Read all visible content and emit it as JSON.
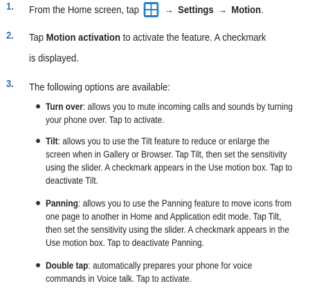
{
  "accent_color": "#2a6fb0",
  "icon_color": "#1f7fcf",
  "icons": [
    "apps-icon",
    "arrow-icon"
  ],
  "steps": [
    {
      "num": "1.",
      "pre": "From the Home screen, tap",
      "arrow": "→",
      "settings": "Settings",
      "motion": "Motion",
      "end": "."
    },
    {
      "num": "2.",
      "pre": "Tap",
      "bold": "Motion activation",
      "post": "to activate the feature. A checkmark",
      "line2": "is displayed."
    },
    {
      "num": "3.",
      "text": "The following options are available:"
    }
  ],
  "options": [
    {
      "term": "Turn over",
      "lines": [
        ": allows you to mute incoming calls and sounds by turning",
        "your phone over. Tap to activate."
      ]
    },
    {
      "term": "Tilt",
      "lines": [
        ": allows you to use the Tilt feature to reduce or enlarge the",
        "screen when in Gallery or Browser. Tap Tilt, then set the sensitivity",
        "using the slider. A checkmark appears in the Use motion box. Tap to",
        "deactivate Tilt."
      ]
    },
    {
      "term": "Panning",
      "lines": [
        ": allows you to use the Panning feature to move icons from",
        "one page to another in Home and Application edit mode. Tap Tilt,",
        "then set the sensitivity using the slider. A checkmark appears in the",
        "Use motion box. Tap to deactivate Panning."
      ]
    },
    {
      "term": "Double tap",
      "lines": [
        ": automatically prepares your phone for voice",
        "commands in Voice talk. Tap to activate."
      ]
    }
  ]
}
